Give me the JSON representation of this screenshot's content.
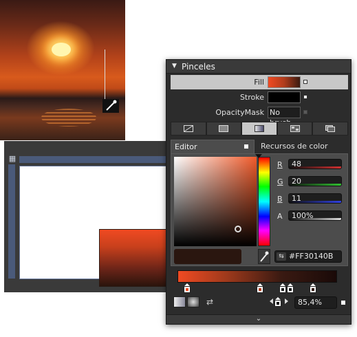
{
  "panel": {
    "title": "Pinceles",
    "brushes": [
      {
        "label": "Fill",
        "swatch": "gradient"
      },
      {
        "label": "Stroke",
        "swatch": "black"
      },
      {
        "label": "OpacityMask",
        "swatch_text": "No brush"
      }
    ],
    "tabs": [
      "no-brush-icon",
      "solid-brush-icon",
      "gradient-brush-icon",
      "tile-brush-icon",
      "resource-brush-icon"
    ],
    "subtab_editor": "Editor",
    "subtab_resources": "Recursos de color",
    "channels": {
      "R": {
        "label": "R",
        "value": "48",
        "color": "#d03030"
      },
      "G": {
        "label": "G",
        "value": "20",
        "color": "#30c030"
      },
      "B": {
        "label": "B",
        "value": "11",
        "color": "#3040e0"
      },
      "A": {
        "label": "A",
        "value": "100%",
        "color": "#cccccc"
      }
    },
    "hex": "#FF30140B",
    "gradient_offset": "85,4%",
    "gradient_stops": [
      {
        "position": 0.05,
        "color": "#f04a22"
      },
      {
        "position": 0.45,
        "color": "#b03c1c"
      },
      {
        "position": 0.6,
        "color": "#1a1a1a"
      },
      {
        "position": 0.64,
        "color": "#1a1a1a"
      },
      {
        "position": 0.85,
        "color": "#30140b"
      }
    ]
  },
  "colors": {
    "panel_bg": "#2c2c2c",
    "selected_row": "#c8c8c8",
    "accent_orange": "#f04a22",
    "selected_color": "#30140b"
  }
}
